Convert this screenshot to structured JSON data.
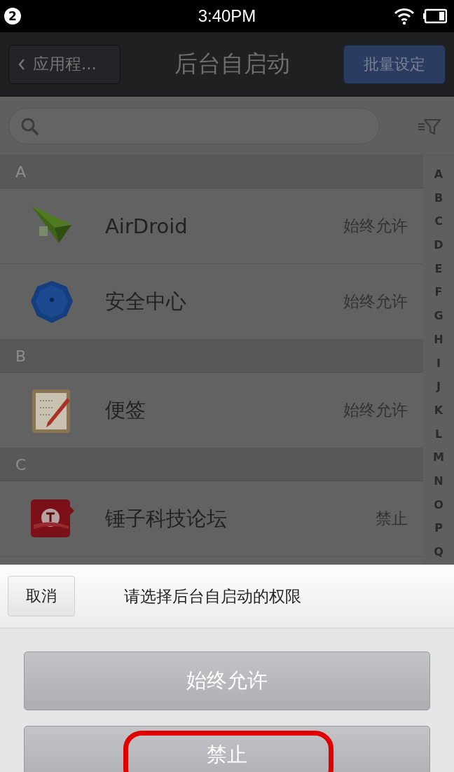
{
  "status_bar": {
    "notification_count": "2",
    "time": "3:40PM"
  },
  "header": {
    "back_label": "应用程...",
    "title": "后台自启动",
    "action": "批量设定"
  },
  "sections": [
    {
      "letter": "A",
      "apps": [
        {
          "name": "AirDroid",
          "permission": "始终允许",
          "kind": "plane"
        },
        {
          "name": "安全中心",
          "permission": "始终允许",
          "kind": "umbrella"
        }
      ]
    },
    {
      "letter": "B",
      "apps": [
        {
          "name": "便签",
          "permission": "始终允许",
          "kind": "notepad"
        }
      ]
    },
    {
      "letter": "C",
      "apps": [
        {
          "name": "锤子科技论坛",
          "permission": "禁止",
          "kind": "forum"
        }
      ]
    }
  ],
  "index_letters": [
    "A",
    "B",
    "C",
    "D",
    "E",
    "F",
    "G",
    "H",
    "I",
    "J",
    "K",
    "L",
    "M",
    "N",
    "O",
    "P",
    "Q"
  ],
  "sheet": {
    "cancel": "取消",
    "prompt": "请选择后台自启动的权限",
    "options": [
      {
        "label": "始终允许",
        "highlighted": false
      },
      {
        "label": "禁止",
        "highlighted": true
      }
    ]
  }
}
